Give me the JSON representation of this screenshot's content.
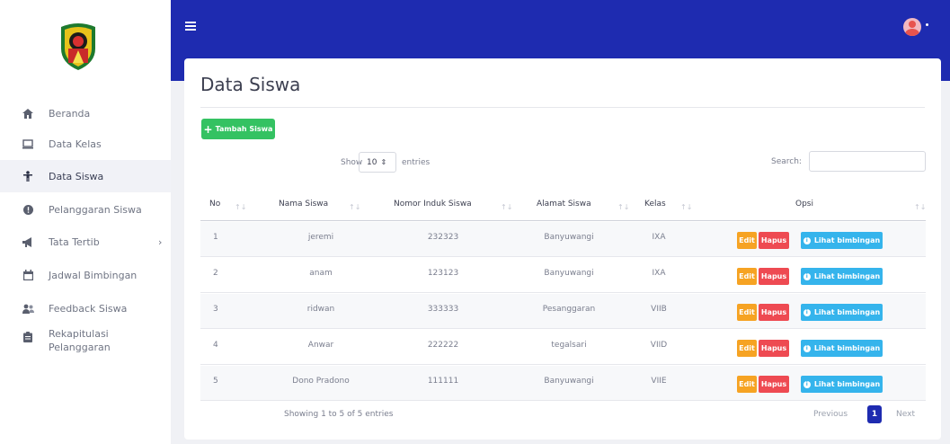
{
  "sidebar": {
    "items": [
      {
        "label": "Beranda",
        "icon": "home-icon"
      },
      {
        "label": "Data Kelas",
        "icon": "monitor-icon"
      },
      {
        "label": "Data Siswa",
        "icon": "child-icon",
        "active": true
      },
      {
        "label": "Pelanggaran Siswa",
        "icon": "alert-circle-icon"
      },
      {
        "label": "Tata Tertib",
        "icon": "megaphone-icon",
        "chevron": "›"
      },
      {
        "label": "Jadwal Bimbingan",
        "icon": "calendar-icon"
      },
      {
        "label": "Feedback Siswa",
        "icon": "users-icon"
      },
      {
        "label": "Rekapitulasi Pelanggaran",
        "icon": "clipboard-icon"
      }
    ]
  },
  "page": {
    "title": "Data Siswa",
    "add_button": "Tambah Siswa"
  },
  "table_controls": {
    "show": "Show",
    "entries_value": "10",
    "entries": "entries",
    "search_label": "Search:"
  },
  "table": {
    "headers": [
      "No",
      "Nama Siswa",
      "Nomor Induk Siswa",
      "Alamat Siswa",
      "Kelas",
      "Opsi"
    ],
    "rows": [
      [
        "1",
        "jeremi",
        "232323",
        "Banyuwangi",
        "IXA"
      ],
      [
        "2",
        "anam",
        "123123",
        "Banyuwangi",
        "IXA"
      ],
      [
        "3",
        "ridwan",
        "333333",
        "Pesanggaran",
        "VIIB"
      ],
      [
        "4",
        "Anwar",
        "222222",
        "tegalsari",
        "VIID"
      ],
      [
        "5",
        "Dono Pradono",
        "111111",
        "Banyuwangi",
        "VIIE"
      ]
    ],
    "actions": {
      "edit": "Edit",
      "hapus": "Hapus",
      "lihat": "Lihat bimbingan"
    }
  },
  "footer": {
    "info": "Showing 1 to 5 of 5 entries",
    "previous": "Previous",
    "page": "1",
    "next": "Next"
  },
  "colors": {
    "brand": "#1e2bb0",
    "add": "#34c262",
    "edit": "#f6a323",
    "hapus": "#ee4a52",
    "lihat": "#35b4ec"
  }
}
